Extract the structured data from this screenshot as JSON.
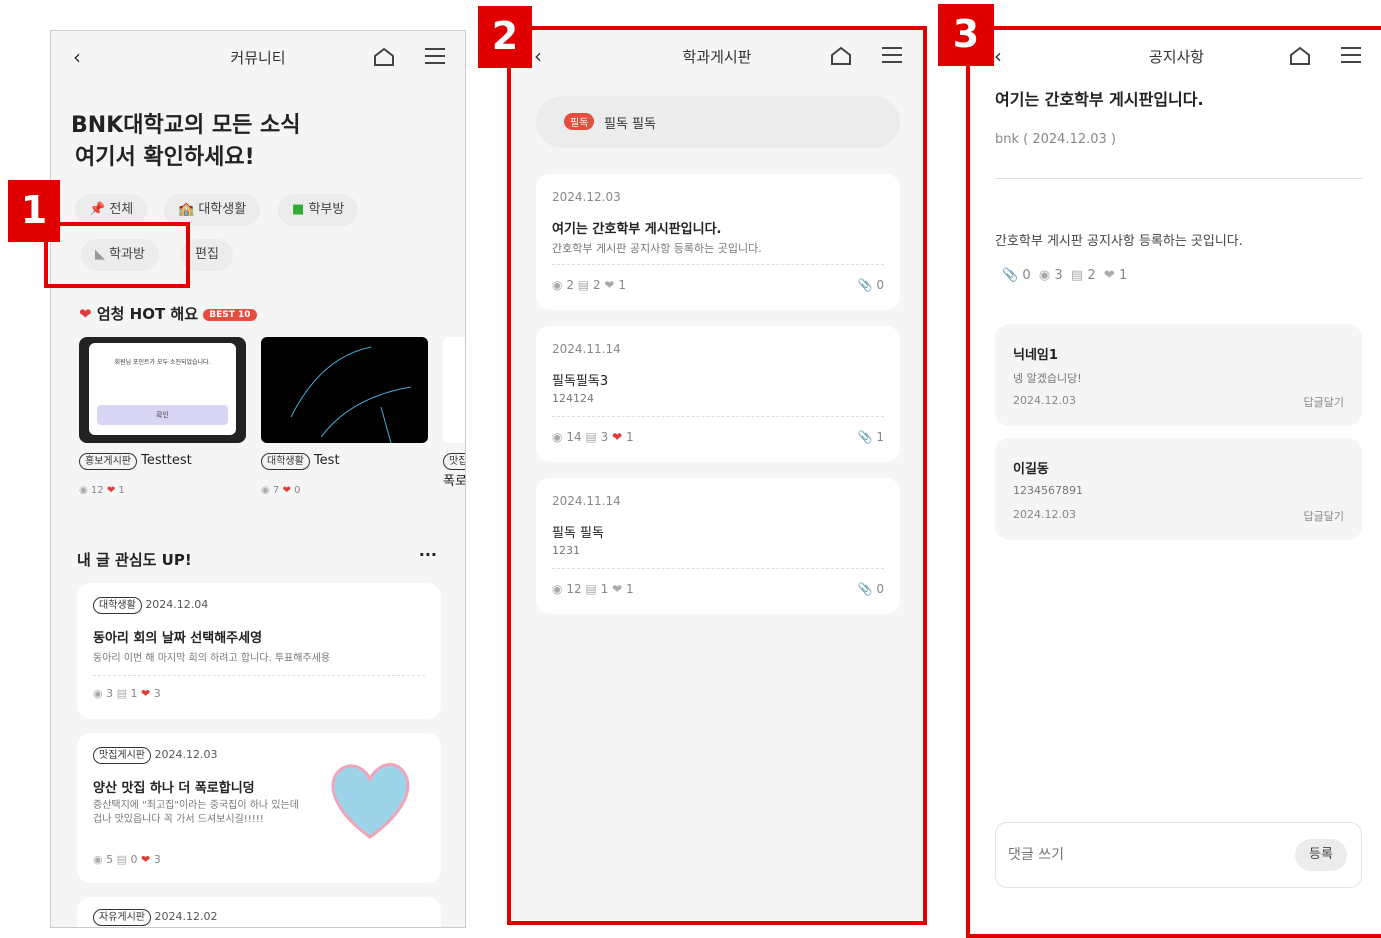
{
  "colors": {
    "accent": "#e10000",
    "heart": "#e23a3a",
    "pill": "#e84c3d"
  },
  "screen1": {
    "title": "커뮤니티",
    "headline1": "BNK대학교의 모든 소식",
    "headline2": "여기서 확인하세요!",
    "chips": [
      "전체",
      "대학생활",
      "학부방",
      "학과방",
      "편집"
    ],
    "hot_title": "엄청 HOT 해요",
    "hot_badge": "BEST 10",
    "hot_cards": [
      {
        "tag": "홍보게시판",
        "title": "Testtest",
        "views": "12",
        "likes": "1",
        "thumb_text": "회원님 포인트가 모두 소진되었습니다.",
        "thumb_btn": "확인"
      },
      {
        "tag": "대학생활",
        "title": "Test",
        "views": "7",
        "likes": "0"
      },
      {
        "tag": "맛집",
        "title": "폭로"
      }
    ],
    "mine_title": "내 글 관심도 UP!",
    "posts": [
      {
        "tag": "대학생활",
        "date": "2024.12.04",
        "title": "동아리 회의 날짜 선택해주세영",
        "body": "동아리 이번 해 마지막 회의 하려고 합니다. 투표해주세용",
        "views": "3",
        "comments": "1",
        "likes": "3"
      },
      {
        "tag": "맛집게시판",
        "date": "2024.12.03",
        "title": "양산 맛집 하나 더 폭로합니덩",
        "body": "증산택지에 \"최고집\"이라는 중국집이 하나 있는데겁나 맛있읍니다 꼭 가서 드셔보시길!!!!!",
        "views": "5",
        "comments": "0",
        "likes": "3"
      },
      {
        "tag": "자유게시판",
        "date": "2024.12.02"
      }
    ]
  },
  "screen2": {
    "title": "학과게시판",
    "notice_badge": "필독",
    "notice_text": "필독 필독",
    "posts": [
      {
        "date": "2024.12.03",
        "title": "여기는 간호학부 게시판입니다.",
        "body": "간호학부 게시판 공지사항 등록하는 곳입니다.",
        "views": "2",
        "comments": "2",
        "likes": "1",
        "files": "0"
      },
      {
        "date": "2024.11.14",
        "title": "필독필독3",
        "body": "124124",
        "views": "14",
        "comments": "3",
        "likes": "1",
        "files": "1"
      },
      {
        "date": "2024.11.14",
        "title": "필독 필독",
        "body": "1231",
        "views": "12",
        "comments": "1",
        "likes": "1",
        "files": "0"
      }
    ]
  },
  "screen3": {
    "title": "공지사항",
    "post_title": "여기는 간호학부 게시판입니다.",
    "author": "bnk ( 2024.12.03 )",
    "body": "간호학부 게시판 공지사항 등록하는 곳입니다.",
    "files": "0",
    "views": "3",
    "comments": "2",
    "likes": "1",
    "comments_list": [
      {
        "name": "닉네임1",
        "text": "넹 알겠습니당!",
        "date": "2024.12.03",
        "reply": "답글달기"
      },
      {
        "name": "이길동",
        "text": "1234567891",
        "date": "2024.12.03",
        "reply": "답글달기"
      }
    ],
    "input_placeholder": "댓글 쓰기",
    "submit": "등록"
  },
  "labels": [
    "1",
    "2",
    "3"
  ]
}
